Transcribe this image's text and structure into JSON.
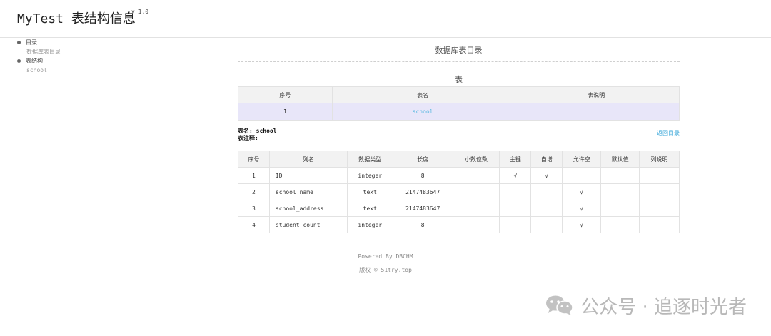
{
  "header": {
    "title": "MyTest 表结构信息",
    "version": "v 1.0"
  },
  "toc": {
    "items": [
      {
        "label": "目录",
        "sub": "数据库表目录"
      },
      {
        "label": "表结构",
        "sub": "school"
      }
    ]
  },
  "catalog": {
    "title": "数据库表目录",
    "caption": "表",
    "headers": [
      "序号",
      "表名",
      "表说明"
    ],
    "rows": [
      {
        "no": "1",
        "name": "school",
        "desc": ""
      }
    ]
  },
  "table_detail": {
    "name_line": "表名: school",
    "comment_line": "表注释:",
    "back_link": "返回目录",
    "headers": [
      "序号",
      "列名",
      "数据类型",
      "长度",
      "小数位数",
      "主键",
      "自增",
      "允许空",
      "默认值",
      "列说明"
    ],
    "rows": [
      {
        "no": "1",
        "name": "ID",
        "type": "integer",
        "length": "8",
        "scale": "",
        "pk": "√",
        "auto": "√",
        "nullable": "",
        "default": "",
        "desc": ""
      },
      {
        "no": "2",
        "name": "school_name",
        "type": "text",
        "length": "2147483647",
        "scale": "",
        "pk": "",
        "auto": "",
        "nullable": "√",
        "default": "",
        "desc": ""
      },
      {
        "no": "3",
        "name": "school_address",
        "type": "text",
        "length": "2147483647",
        "scale": "",
        "pk": "",
        "auto": "",
        "nullable": "√",
        "default": "",
        "desc": ""
      },
      {
        "no": "4",
        "name": "student_count",
        "type": "integer",
        "length": "8",
        "scale": "",
        "pk": "",
        "auto": "",
        "nullable": "√",
        "default": "",
        "desc": ""
      }
    ]
  },
  "footer": {
    "powered": "Powered By DBCHM",
    "copyright": "版权 © 51try.top"
  },
  "watermark": {
    "text": "公众号 · 追逐时光者",
    "icon": "wechat-icon"
  }
}
